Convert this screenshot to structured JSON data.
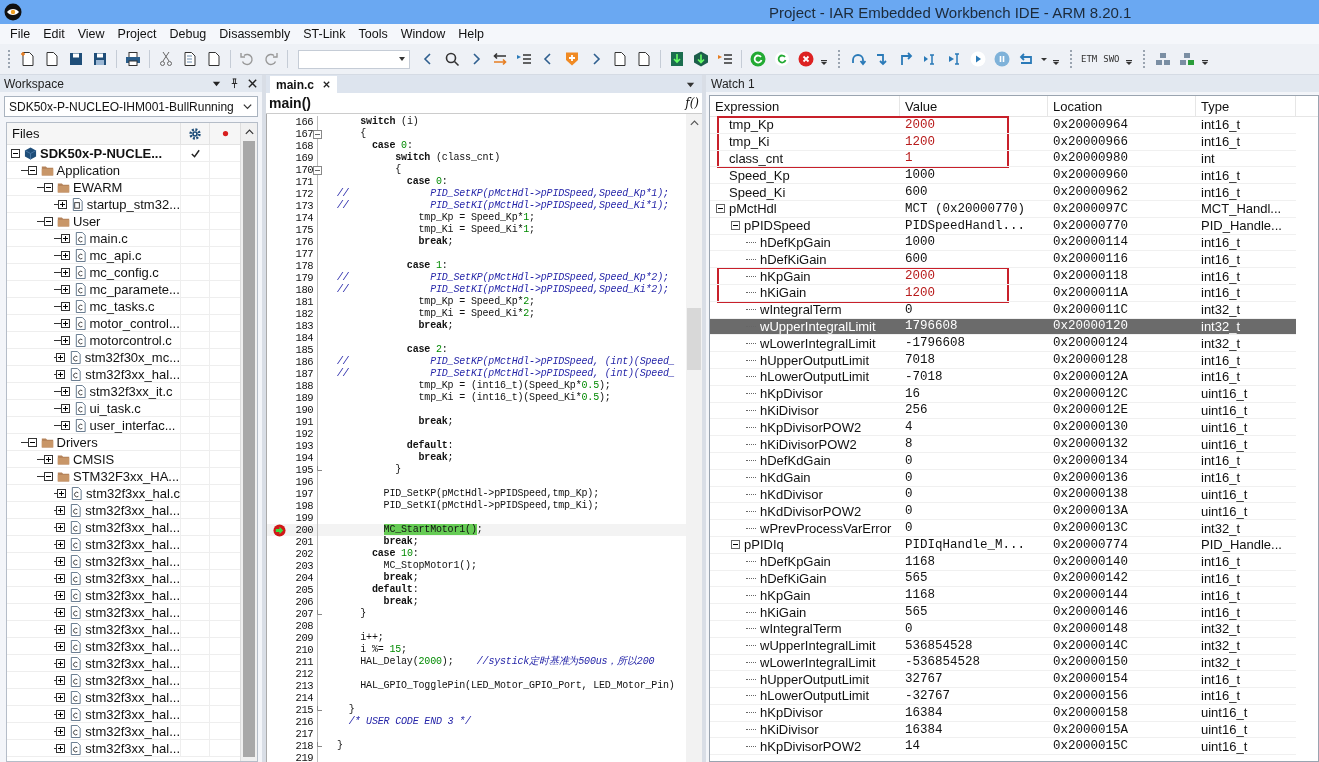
{
  "window": {
    "title": "Project - IAR Embedded Workbench IDE - ARM 8.20.1"
  },
  "menu": [
    "File",
    "Edit",
    "View",
    "Project",
    "Debug",
    "Disassembly",
    "ST-Link",
    "Tools",
    "Window",
    "Help"
  ],
  "toolbar": {
    "labels": [
      "ETM",
      "SWO"
    ]
  },
  "workspace": {
    "title": "Workspace",
    "configuration": "SDK50x-P-NUCLEO-IHM001-BullRunning",
    "files_header": "Files",
    "tree": [
      {
        "kind": "project",
        "name": "SDK50x-P-NUCLE...",
        "checked": true,
        "expanded": true,
        "children": [
          {
            "kind": "folder",
            "name": "Application",
            "expanded": true,
            "children": [
              {
                "kind": "folder",
                "name": "EWARM",
                "expanded": true,
                "children": [
                  {
                    "kind": "asm_file",
                    "name": "startup_stm32...",
                    "expanded": false
                  }
                ]
              },
              {
                "kind": "folder",
                "name": "User",
                "expanded": true,
                "children": [
                  {
                    "kind": "c_file",
                    "name": "main.c",
                    "expanded": false
                  },
                  {
                    "kind": "c_file",
                    "name": "mc_api.c",
                    "expanded": false
                  },
                  {
                    "kind": "c_file",
                    "name": "mc_config.c",
                    "expanded": false
                  },
                  {
                    "kind": "c_file",
                    "name": "mc_paramete...",
                    "expanded": false
                  },
                  {
                    "kind": "c_file",
                    "name": "mc_tasks.c",
                    "expanded": false
                  },
                  {
                    "kind": "c_file",
                    "name": "motor_control...",
                    "expanded": false
                  },
                  {
                    "kind": "c_file",
                    "name": "motorcontrol.c",
                    "expanded": false
                  },
                  {
                    "kind": "c_file",
                    "name": "stm32f30x_mc...",
                    "expanded": false
                  },
                  {
                    "kind": "c_file",
                    "name": "stm32f3xx_hal...",
                    "expanded": false
                  },
                  {
                    "kind": "c_file",
                    "name": "stm32f3xx_it.c",
                    "expanded": false
                  },
                  {
                    "kind": "c_file",
                    "name": "ui_task.c",
                    "expanded": false
                  },
                  {
                    "kind": "c_file",
                    "name": "user_interfac...",
                    "expanded": false
                  }
                ]
              }
            ]
          },
          {
            "kind": "folder",
            "name": "Drivers",
            "expanded": true,
            "children": [
              {
                "kind": "folder",
                "name": "CMSIS",
                "expanded": false
              },
              {
                "kind": "folder",
                "name": "STM32F3xx_HA...",
                "expanded": true,
                "children": [
                  {
                    "kind": "c_file",
                    "name": "stm32f3xx_hal.c",
                    "expanded": false
                  },
                  {
                    "kind": "c_file",
                    "name": "stm32f3xx_hal...",
                    "expanded": false
                  },
                  {
                    "kind": "c_file",
                    "name": "stm32f3xx_hal...",
                    "expanded": false
                  },
                  {
                    "kind": "c_file",
                    "name": "stm32f3xx_hal...",
                    "expanded": false
                  },
                  {
                    "kind": "c_file",
                    "name": "stm32f3xx_hal...",
                    "expanded": false
                  },
                  {
                    "kind": "c_file",
                    "name": "stm32f3xx_hal...",
                    "expanded": false
                  },
                  {
                    "kind": "c_file",
                    "name": "stm32f3xx_hal...",
                    "expanded": false
                  },
                  {
                    "kind": "c_file",
                    "name": "stm32f3xx_hal...",
                    "expanded": false
                  },
                  {
                    "kind": "c_file",
                    "name": "stm32f3xx_hal...",
                    "expanded": false
                  },
                  {
                    "kind": "c_file",
                    "name": "stm32f3xx_hal...",
                    "expanded": false
                  },
                  {
                    "kind": "c_file",
                    "name": "stm32f3xx_hal...",
                    "expanded": false
                  },
                  {
                    "kind": "c_file",
                    "name": "stm32f3xx_hal...",
                    "expanded": false
                  },
                  {
                    "kind": "c_file",
                    "name": "stm32f3xx_hal...",
                    "expanded": false
                  },
                  {
                    "kind": "c_file",
                    "name": "stm32f3xx_hal...",
                    "expanded": false
                  },
                  {
                    "kind": "c_file",
                    "name": "stm32f3xx_hal...",
                    "expanded": false
                  },
                  {
                    "kind": "c_file",
                    "name": "stm32f3xx_hal...",
                    "expanded": false
                  }
                ]
              }
            ]
          }
        ]
      }
    ]
  },
  "editor": {
    "tabs": [
      {
        "label": "main.c",
        "selected": true
      }
    ],
    "function": "main()",
    "function_icon": "f()",
    "lines": [
      {
        "num": "166",
        "current": false,
        "tokens": [
          {
            "text": "    switch",
            "kind": "keyword"
          },
          {
            "text": " (i)",
            "kind": "plain"
          }
        ]
      },
      {
        "num": "167",
        "fold_open": true,
        "current": false,
        "tokens": [
          {
            "text": "    {",
            "kind": "plain"
          }
        ]
      },
      {
        "num": "168",
        "current": false,
        "tokens": [
          {
            "text": "      case",
            "kind": "keyword"
          },
          {
            "text": " 0",
            "kind": "number"
          },
          {
            "text": ":",
            "kind": "plain"
          }
        ]
      },
      {
        "num": "169",
        "current": false,
        "tokens": [
          {
            "text": "          switch",
            "kind": "keyword"
          },
          {
            "text": " (class_cnt)",
            "kind": "plain"
          }
        ]
      },
      {
        "num": "170",
        "fold_open": true,
        "current": false,
        "tokens": [
          {
            "text": "          {",
            "kind": "plain"
          }
        ]
      },
      {
        "num": "171",
        "current": false,
        "tokens": [
          {
            "text": "            case",
            "kind": "keyword"
          },
          {
            "text": " 0",
            "kind": "number"
          },
          {
            "text": ":",
            "kind": "plain"
          }
        ]
      },
      {
        "num": "172",
        "current": false,
        "tokens": [
          {
            "text": "//              PID_SetKP(pMctHdl->pPIDSpeed,Speed_Kp*1);",
            "kind": "comment"
          }
        ]
      },
      {
        "num": "173",
        "current": false,
        "tokens": [
          {
            "text": "//              PID_SetKI(pMctHdl->pPIDSpeed,Speed_Ki*1);",
            "kind": "comment"
          }
        ]
      },
      {
        "num": "174",
        "current": false,
        "tokens": [
          {
            "text": "              tmp_Kp = Speed_Kp*",
            "kind": "plain"
          },
          {
            "text": "1",
            "kind": "number"
          },
          {
            "text": ";",
            "kind": "plain"
          }
        ]
      },
      {
        "num": "175",
        "current": false,
        "tokens": [
          {
            "text": "              tmp_Ki = Speed_Ki*",
            "kind": "plain"
          },
          {
            "text": "1",
            "kind": "number"
          },
          {
            "text": ";",
            "kind": "plain"
          }
        ]
      },
      {
        "num": "176",
        "current": false,
        "tokens": [
          {
            "text": "              break",
            "kind": "keyword"
          },
          {
            "text": ";",
            "kind": "plain"
          }
        ]
      },
      {
        "num": "177",
        "current": false
      },
      {
        "num": "178",
        "current": false,
        "tokens": [
          {
            "text": "            case",
            "kind": "keyword"
          },
          {
            "text": " 1",
            "kind": "number"
          },
          {
            "text": ":",
            "kind": "plain"
          }
        ]
      },
      {
        "num": "179",
        "current": false,
        "tokens": [
          {
            "text": "//              PID_SetKP(pMctHdl->pPIDSpeed,Speed_Kp*2);",
            "kind": "comment"
          }
        ]
      },
      {
        "num": "180",
        "current": false,
        "tokens": [
          {
            "text": "//              PID_SetKI(pMctHdl->pPIDSpeed,Speed_Ki*2);",
            "kind": "comment"
          }
        ]
      },
      {
        "num": "181",
        "current": false,
        "tokens": [
          {
            "text": "              tmp_Kp = Speed_Kp*",
            "kind": "plain"
          },
          {
            "text": "2",
            "kind": "number"
          },
          {
            "text": ";",
            "kind": "plain"
          }
        ]
      },
      {
        "num": "182",
        "current": false,
        "tokens": [
          {
            "text": "              tmp_Ki = Speed_Ki*",
            "kind": "plain"
          },
          {
            "text": "2",
            "kind": "number"
          },
          {
            "text": ";",
            "kind": "plain"
          }
        ]
      },
      {
        "num": "183",
        "current": false,
        "tokens": [
          {
            "text": "              break",
            "kind": "keyword"
          },
          {
            "text": ";",
            "kind": "plain"
          }
        ]
      },
      {
        "num": "184",
        "current": false
      },
      {
        "num": "185",
        "current": false,
        "tokens": [
          {
            "text": "            case",
            "kind": "keyword"
          },
          {
            "text": " 2",
            "kind": "number"
          },
          {
            "text": ":",
            "kind": "plain"
          }
        ]
      },
      {
        "num": "186",
        "current": false,
        "tokens": [
          {
            "text": "//              PID_SetKP(pMctHdl->pPIDSpeed, (int)(Speed_",
            "kind": "comment"
          }
        ]
      },
      {
        "num": "187",
        "current": false,
        "tokens": [
          {
            "text": "//              PID_SetKI(pMctHdl->pPIDSpeed, (int)(Speed_",
            "kind": "comment"
          }
        ]
      },
      {
        "num": "188",
        "current": false,
        "tokens": [
          {
            "text": "              tmp_Kp = (int16_t)(Speed_Kp*",
            "kind": "plain"
          },
          {
            "text": "0.5",
            "kind": "number"
          },
          {
            "text": ");",
            "kind": "plain"
          }
        ]
      },
      {
        "num": "189",
        "current": false,
        "tokens": [
          {
            "text": "              tmp_Ki = (int16_t)(Speed_Ki*",
            "kind": "plain"
          },
          {
            "text": "0.5",
            "kind": "number"
          },
          {
            "text": ");",
            "kind": "plain"
          }
        ]
      },
      {
        "num": "190",
        "current": false
      },
      {
        "num": "191",
        "current": false,
        "tokens": [
          {
            "text": "              break",
            "kind": "keyword"
          },
          {
            "text": ";",
            "kind": "plain"
          }
        ]
      },
      {
        "num": "192",
        "current": false
      },
      {
        "num": "193",
        "current": false,
        "tokens": [
          {
            "text": "            default",
            "kind": "keyword"
          },
          {
            "text": ":",
            "kind": "plain"
          }
        ]
      },
      {
        "num": "194",
        "current": false,
        "tokens": [
          {
            "text": "              break",
            "kind": "keyword"
          },
          {
            "text": ";",
            "kind": "plain"
          }
        ]
      },
      {
        "num": "195",
        "fold_end": true,
        "current": false,
        "tokens": [
          {
            "text": "          }",
            "kind": "plain"
          }
        ]
      },
      {
        "num": "196",
        "current": false
      },
      {
        "num": "197",
        "current": false,
        "tokens": [
          {
            "text": "        PID_SetKP(pMctHdl->pPIDSpeed,tmp_Kp);",
            "kind": "plain"
          }
        ]
      },
      {
        "num": "198",
        "current": false,
        "tokens": [
          {
            "text": "        PID_SetKI(pMctHdl->pPIDSpeed,tmp_Ki);",
            "kind": "plain"
          }
        ]
      },
      {
        "num": "199",
        "current": false
      },
      {
        "num": "200",
        "current": true,
        "tokens": [
          {
            "text": "        MC_StartMotor1()",
            "kind": "highlight"
          },
          {
            "text": ";",
            "kind": "plain"
          }
        ]
      },
      {
        "num": "201",
        "current": false,
        "tokens": [
          {
            "text": "        break",
            "kind": "keyword"
          },
          {
            "text": ";",
            "kind": "plain"
          }
        ]
      },
      {
        "num": "202",
        "current": false,
        "tokens": [
          {
            "text": "      case",
            "kind": "keyword"
          },
          {
            "text": " 10",
            "kind": "number"
          },
          {
            "text": ":",
            "kind": "plain"
          }
        ]
      },
      {
        "num": "203",
        "current": false,
        "tokens": [
          {
            "text": "        MC_StopMotor1();",
            "kind": "plain"
          }
        ]
      },
      {
        "num": "204",
        "current": false,
        "tokens": [
          {
            "text": "        break",
            "kind": "keyword"
          },
          {
            "text": ";",
            "kind": "plain"
          }
        ]
      },
      {
        "num": "205",
        "current": false,
        "tokens": [
          {
            "text": "      default",
            "kind": "keyword"
          },
          {
            "text": ":",
            "kind": "plain"
          }
        ]
      },
      {
        "num": "206",
        "current": false,
        "tokens": [
          {
            "text": "        break",
            "kind": "keyword"
          },
          {
            "text": ";",
            "kind": "plain"
          }
        ]
      },
      {
        "num": "207",
        "fold_end": true,
        "current": false,
        "tokens": [
          {
            "text": "    }",
            "kind": "plain"
          }
        ]
      },
      {
        "num": "208",
        "current": false
      },
      {
        "num": "209",
        "current": false,
        "tokens": [
          {
            "text": "    i++;",
            "kind": "plain"
          }
        ]
      },
      {
        "num": "210",
        "current": false,
        "tokens": [
          {
            "text": "    i %=",
            "kind": "plain"
          },
          {
            "text": " 15",
            "kind": "number"
          },
          {
            "text": ";",
            "kind": "plain"
          }
        ]
      },
      {
        "num": "211",
        "current": false,
        "tokens": [
          {
            "text": "    HAL_Delay(",
            "kind": "plain"
          },
          {
            "text": "2000",
            "kind": "number"
          },
          {
            "text": ");",
            "kind": "plain"
          },
          {
            "text": "    //systick定时基准为500us，所以200",
            "kind": "comment"
          }
        ]
      },
      {
        "num": "212",
        "current": false
      },
      {
        "num": "213",
        "current": false,
        "tokens": [
          {
            "text": "    HAL_GPIO_TogglePin(LED_Motor_GPIO_Port, LED_Motor_Pin)",
            "kind": "plain"
          }
        ]
      },
      {
        "num": "214",
        "current": false
      },
      {
        "num": "215",
        "fold_end": true,
        "current": false,
        "tokens": [
          {
            "text": "  }",
            "kind": "plain"
          }
        ]
      },
      {
        "num": "216",
        "current": false,
        "tokens": [
          {
            "text": "  /* USER CODE END 3 */",
            "kind": "comment"
          }
        ]
      },
      {
        "num": "217",
        "current": false
      },
      {
        "num": "218",
        "fold_end": true,
        "current": false,
        "tokens": [
          {
            "text": "}",
            "kind": "plain"
          }
        ]
      },
      {
        "num": "219",
        "current": false
      }
    ]
  },
  "watch": {
    "title": "Watch 1",
    "columns": [
      "Expression",
      "Value",
      "Location",
      "Type"
    ],
    "rows": [
      {
        "expression": "tmp_Kp",
        "value": "2000",
        "location": "0x20000964",
        "type": "int16_t",
        "changed": true,
        "boxed": true,
        "selected": false
      },
      {
        "expression": "tmp_Ki",
        "value": "1200",
        "location": "0x20000966",
        "type": "int16_t",
        "changed": true,
        "boxed": true,
        "selected": false
      },
      {
        "expression": "class_cnt",
        "value": "1",
        "location": "0x20000980",
        "type": "int",
        "changed": true,
        "boxed": true,
        "selected": false
      },
      {
        "expression": "Speed_Kp",
        "value": "1000",
        "location": "0x20000960",
        "type": "int16_t",
        "changed": false,
        "boxed": false,
        "selected": false
      },
      {
        "expression": "Speed_Ki",
        "value": "600",
        "location": "0x20000962",
        "type": "int16_t",
        "changed": false,
        "boxed": false,
        "selected": false
      },
      {
        "expression": "pMctHdl",
        "value": "MCT (0x20000770)",
        "location": "0x2000097C",
        "type": "MCT_Handl...",
        "changed": false,
        "boxed": false,
        "selected": false,
        "expanded": true,
        "children": [
          {
            "expression": "pPIDSpeed",
            "value": "PIDSpeedHandl...",
            "location": "0x20000770",
            "type": "PID_Handle...",
            "changed": false,
            "boxed": false,
            "selected": false,
            "expanded": true,
            "children": [
              {
                "expression": "hDefKpGain",
                "value": "1000",
                "location": "0x20000114",
                "type": "int16_t",
                "changed": false,
                "boxed": false,
                "selected": false
              },
              {
                "expression": "hDefKiGain",
                "value": "600",
                "location": "0x20000116",
                "type": "int16_t",
                "changed": false,
                "boxed": false,
                "selected": false
              },
              {
                "expression": "hKpGain",
                "value": "2000",
                "location": "0x20000118",
                "type": "int16_t",
                "changed": true,
                "boxed": true,
                "selected": false
              },
              {
                "expression": "hKiGain",
                "value": "1200",
                "location": "0x2000011A",
                "type": "int16_t",
                "changed": true,
                "boxed": true,
                "selected": false
              },
              {
                "expression": "wIntegralTerm",
                "value": "0",
                "location": "0x2000011C",
                "type": "int32_t",
                "changed": false,
                "boxed": false,
                "selected": false
              },
              {
                "expression": "wUpperIntegralLimit",
                "value": "1796608",
                "location": "0x20000120",
                "type": "int32_t",
                "changed": false,
                "boxed": false,
                "selected": true
              },
              {
                "expression": "wLowerIntegralLimit",
                "value": "-1796608",
                "location": "0x20000124",
                "type": "int32_t",
                "changed": false,
                "boxed": false,
                "selected": false
              },
              {
                "expression": "hUpperOutputLimit",
                "value": "7018",
                "location": "0x20000128",
                "type": "int16_t",
                "changed": false,
                "boxed": false,
                "selected": false
              },
              {
                "expression": "hLowerOutputLimit",
                "value": "-7018",
                "location": "0x2000012A",
                "type": "int16_t",
                "changed": false,
                "boxed": false,
                "selected": false
              },
              {
                "expression": "hKpDivisor",
                "value": "16",
                "location": "0x2000012C",
                "type": "uint16_t",
                "changed": false,
                "boxed": false,
                "selected": false
              },
              {
                "expression": "hKiDivisor",
                "value": "256",
                "location": "0x2000012E",
                "type": "uint16_t",
                "changed": false,
                "boxed": false,
                "selected": false
              },
              {
                "expression": "hKpDivisorPOW2",
                "value": "4",
                "location": "0x20000130",
                "type": "uint16_t",
                "changed": false,
                "boxed": false,
                "selected": false
              },
              {
                "expression": "hKiDivisorPOW2",
                "value": "8",
                "location": "0x20000132",
                "type": "uint16_t",
                "changed": false,
                "boxed": false,
                "selected": false
              },
              {
                "expression": "hDefKdGain",
                "value": "0",
                "location": "0x20000134",
                "type": "int16_t",
                "changed": false,
                "boxed": false,
                "selected": false
              },
              {
                "expression": "hKdGain",
                "value": "0",
                "location": "0x20000136",
                "type": "int16_t",
                "changed": false,
                "boxed": false,
                "selected": false
              },
              {
                "expression": "hKdDivisor",
                "value": "0",
                "location": "0x20000138",
                "type": "uint16_t",
                "changed": false,
                "boxed": false,
                "selected": false
              },
              {
                "expression": "hKdDivisorPOW2",
                "value": "0",
                "location": "0x2000013A",
                "type": "uint16_t",
                "changed": false,
                "boxed": false,
                "selected": false
              },
              {
                "expression": "wPrevProcessVarError",
                "value": "0",
                "location": "0x2000013C",
                "type": "int32_t",
                "changed": false,
                "boxed": false,
                "selected": false
              }
            ]
          },
          {
            "expression": "pPIDIq",
            "value": "PIDIqHandle_M...",
            "location": "0x20000774",
            "type": "PID_Handle...",
            "changed": false,
            "boxed": false,
            "selected": false,
            "expanded": true,
            "children": [
              {
                "expression": "hDefKpGain",
                "value": "1168",
                "location": "0x20000140",
                "type": "int16_t",
                "changed": false,
                "boxed": false,
                "selected": false
              },
              {
                "expression": "hDefKiGain",
                "value": "565",
                "location": "0x20000142",
                "type": "int16_t",
                "changed": false,
                "boxed": false,
                "selected": false
              },
              {
                "expression": "hKpGain",
                "value": "1168",
                "location": "0x20000144",
                "type": "int16_t",
                "changed": false,
                "boxed": false,
                "selected": false
              },
              {
                "expression": "hKiGain",
                "value": "565",
                "location": "0x20000146",
                "type": "int16_t",
                "changed": false,
                "boxed": false,
                "selected": false
              },
              {
                "expression": "wIntegralTerm",
                "value": "0",
                "location": "0x20000148",
                "type": "int32_t",
                "changed": false,
                "boxed": false,
                "selected": false
              },
              {
                "expression": "wUpperIntegralLimit",
                "value": "536854528",
                "location": "0x2000014C",
                "type": "int32_t",
                "changed": false,
                "boxed": false,
                "selected": false
              },
              {
                "expression": "wLowerIntegralLimit",
                "value": "-536854528",
                "location": "0x20000150",
                "type": "int32_t",
                "changed": false,
                "boxed": false,
                "selected": false
              },
              {
                "expression": "hUpperOutputLimit",
                "value": "32767",
                "location": "0x20000154",
                "type": "int16_t",
                "changed": false,
                "boxed": false,
                "selected": false
              },
              {
                "expression": "hLowerOutputLimit",
                "value": "-32767",
                "location": "0x20000156",
                "type": "int16_t",
                "changed": false,
                "boxed": false,
                "selected": false
              },
              {
                "expression": "hKpDivisor",
                "value": "16384",
                "location": "0x20000158",
                "type": "uint16_t",
                "changed": false,
                "boxed": false,
                "selected": false
              },
              {
                "expression": "hKiDivisor",
                "value": "16384",
                "location": "0x2000015A",
                "type": "uint16_t",
                "changed": false,
                "boxed": false,
                "selected": false
              },
              {
                "expression": "hKpDivisorPOW2",
                "value": "14",
                "location": "0x2000015C",
                "type": "uint16_t",
                "changed": false,
                "boxed": false,
                "selected": false
              }
            ]
          }
        ]
      }
    ]
  }
}
